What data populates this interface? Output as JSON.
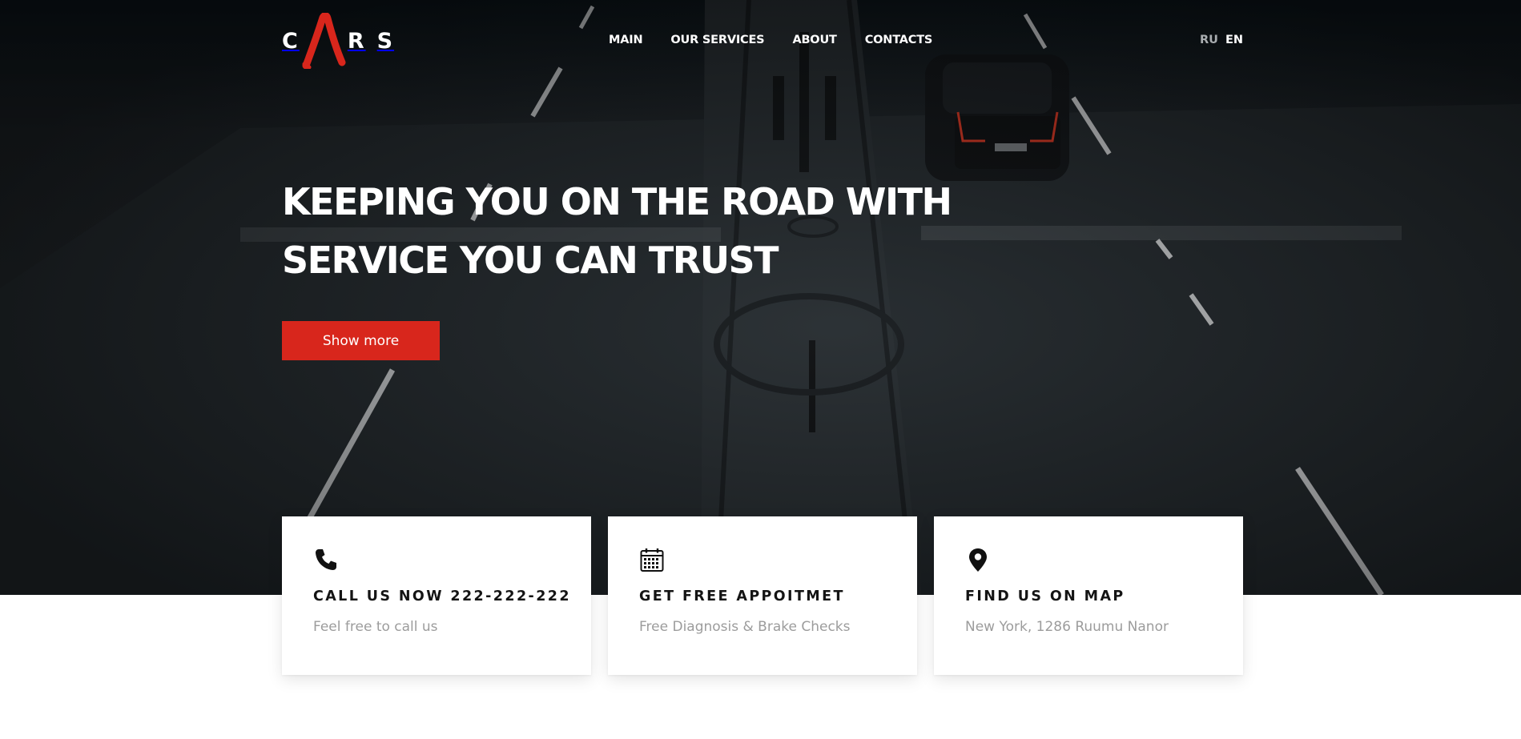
{
  "brand": {
    "logo_letters": [
      "C",
      "R",
      "S"
    ],
    "accent_color": "#d8261c"
  },
  "nav": {
    "items": [
      {
        "label": "MAIN"
      },
      {
        "label": "OUR SERVICES"
      },
      {
        "label": "ABOUT"
      },
      {
        "label": "CONTACTS"
      }
    ]
  },
  "languages": {
    "ru": "RU",
    "en": "EN",
    "active": "EN"
  },
  "hero": {
    "headline_line1": "KEEPING YOU ON THE ROAD WITH",
    "headline_line2": "SERVICE YOU CAN TRUST",
    "cta_label": "Show more"
  },
  "cards": [
    {
      "icon": "phone-icon",
      "title": "CALL US NOW 222-222-222",
      "subtitle": "Feel free to call us"
    },
    {
      "icon": "calendar-icon",
      "title": "GET FREE APPOITMET",
      "subtitle": "Free Diagnosis & Brake Checks"
    },
    {
      "icon": "map-pin-icon",
      "title": "FIND US ON MAP",
      "subtitle": "New York, 1286 Ruumu Nanor"
    }
  ]
}
